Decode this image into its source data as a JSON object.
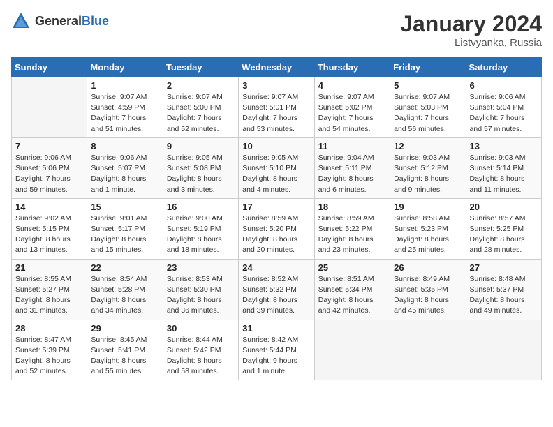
{
  "header": {
    "logo_general": "General",
    "logo_blue": "Blue",
    "month_year": "January 2024",
    "location": "Listvyanka, Russia"
  },
  "weekdays": [
    "Sunday",
    "Monday",
    "Tuesday",
    "Wednesday",
    "Thursday",
    "Friday",
    "Saturday"
  ],
  "weeks": [
    [
      {
        "day": "",
        "info": ""
      },
      {
        "day": "1",
        "info": "Sunrise: 9:07 AM\nSunset: 4:59 PM\nDaylight: 7 hours\nand 51 minutes."
      },
      {
        "day": "2",
        "info": "Sunrise: 9:07 AM\nSunset: 5:00 PM\nDaylight: 7 hours\nand 52 minutes."
      },
      {
        "day": "3",
        "info": "Sunrise: 9:07 AM\nSunset: 5:01 PM\nDaylight: 7 hours\nand 53 minutes."
      },
      {
        "day": "4",
        "info": "Sunrise: 9:07 AM\nSunset: 5:02 PM\nDaylight: 7 hours\nand 54 minutes."
      },
      {
        "day": "5",
        "info": "Sunrise: 9:07 AM\nSunset: 5:03 PM\nDaylight: 7 hours\nand 56 minutes."
      },
      {
        "day": "6",
        "info": "Sunrise: 9:06 AM\nSunset: 5:04 PM\nDaylight: 7 hours\nand 57 minutes."
      }
    ],
    [
      {
        "day": "7",
        "info": "Sunrise: 9:06 AM\nSunset: 5:06 PM\nDaylight: 7 hours\nand 59 minutes."
      },
      {
        "day": "8",
        "info": "Sunrise: 9:06 AM\nSunset: 5:07 PM\nDaylight: 8 hours\nand 1 minute."
      },
      {
        "day": "9",
        "info": "Sunrise: 9:05 AM\nSunset: 5:08 PM\nDaylight: 8 hours\nand 3 minutes."
      },
      {
        "day": "10",
        "info": "Sunrise: 9:05 AM\nSunset: 5:10 PM\nDaylight: 8 hours\nand 4 minutes."
      },
      {
        "day": "11",
        "info": "Sunrise: 9:04 AM\nSunset: 5:11 PM\nDaylight: 8 hours\nand 6 minutes."
      },
      {
        "day": "12",
        "info": "Sunrise: 9:03 AM\nSunset: 5:12 PM\nDaylight: 8 hours\nand 9 minutes."
      },
      {
        "day": "13",
        "info": "Sunrise: 9:03 AM\nSunset: 5:14 PM\nDaylight: 8 hours\nand 11 minutes."
      }
    ],
    [
      {
        "day": "14",
        "info": "Sunrise: 9:02 AM\nSunset: 5:15 PM\nDaylight: 8 hours\nand 13 minutes."
      },
      {
        "day": "15",
        "info": "Sunrise: 9:01 AM\nSunset: 5:17 PM\nDaylight: 8 hours\nand 15 minutes."
      },
      {
        "day": "16",
        "info": "Sunrise: 9:00 AM\nSunset: 5:19 PM\nDaylight: 8 hours\nand 18 minutes."
      },
      {
        "day": "17",
        "info": "Sunrise: 8:59 AM\nSunset: 5:20 PM\nDaylight: 8 hours\nand 20 minutes."
      },
      {
        "day": "18",
        "info": "Sunrise: 8:59 AM\nSunset: 5:22 PM\nDaylight: 8 hours\nand 23 minutes."
      },
      {
        "day": "19",
        "info": "Sunrise: 8:58 AM\nSunset: 5:23 PM\nDaylight: 8 hours\nand 25 minutes."
      },
      {
        "day": "20",
        "info": "Sunrise: 8:57 AM\nSunset: 5:25 PM\nDaylight: 8 hours\nand 28 minutes."
      }
    ],
    [
      {
        "day": "21",
        "info": "Sunrise: 8:55 AM\nSunset: 5:27 PM\nDaylight: 8 hours\nand 31 minutes."
      },
      {
        "day": "22",
        "info": "Sunrise: 8:54 AM\nSunset: 5:28 PM\nDaylight: 8 hours\nand 34 minutes."
      },
      {
        "day": "23",
        "info": "Sunrise: 8:53 AM\nSunset: 5:30 PM\nDaylight: 8 hours\nand 36 minutes."
      },
      {
        "day": "24",
        "info": "Sunrise: 8:52 AM\nSunset: 5:32 PM\nDaylight: 8 hours\nand 39 minutes."
      },
      {
        "day": "25",
        "info": "Sunrise: 8:51 AM\nSunset: 5:34 PM\nDaylight: 8 hours\nand 42 minutes."
      },
      {
        "day": "26",
        "info": "Sunrise: 8:49 AM\nSunset: 5:35 PM\nDaylight: 8 hours\nand 45 minutes."
      },
      {
        "day": "27",
        "info": "Sunrise: 8:48 AM\nSunset: 5:37 PM\nDaylight: 8 hours\nand 49 minutes."
      }
    ],
    [
      {
        "day": "28",
        "info": "Sunrise: 8:47 AM\nSunset: 5:39 PM\nDaylight: 8 hours\nand 52 minutes."
      },
      {
        "day": "29",
        "info": "Sunrise: 8:45 AM\nSunset: 5:41 PM\nDaylight: 8 hours\nand 55 minutes."
      },
      {
        "day": "30",
        "info": "Sunrise: 8:44 AM\nSunset: 5:42 PM\nDaylight: 8 hours\nand 58 minutes."
      },
      {
        "day": "31",
        "info": "Sunrise: 8:42 AM\nSunset: 5:44 PM\nDaylight: 9 hours\nand 1 minute."
      },
      {
        "day": "",
        "info": ""
      },
      {
        "day": "",
        "info": ""
      },
      {
        "day": "",
        "info": ""
      }
    ]
  ]
}
